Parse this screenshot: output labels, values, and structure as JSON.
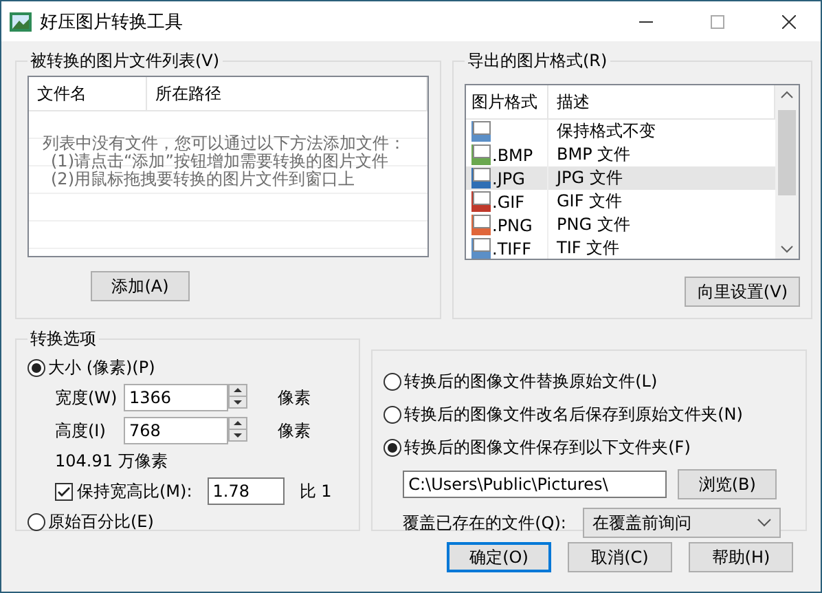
{
  "window": {
    "title": "好压图片转换工具"
  },
  "file_list": {
    "title": "被转换的图片文件列表(V)",
    "columns": [
      "文件名",
      "所在路径"
    ],
    "empty_message": [
      "列表中没有文件，您可以通过以下方法添加文件：",
      "(1)请点击“添加”按钮增加需要转换的图片文件",
      "(2)用鼠标拖拽要转换的图片文件到窗口上"
    ],
    "add_button": "添加(A)"
  },
  "formats": {
    "title": "导出的图片格式(R)",
    "columns": [
      "图片格式",
      "描述"
    ],
    "rows": [
      {
        "format": "",
        "description": "保持格式不变",
        "color": "#5b8fc7",
        "selected": false
      },
      {
        "format": ".BMP",
        "description": "BMP 文件",
        "color": "#6aa84f",
        "selected": false
      },
      {
        "format": ".JPG",
        "description": "JPG 文件",
        "color": "#2f6fb5",
        "selected": true
      },
      {
        "format": ".GIF",
        "description": "GIF 文件",
        "color": "#c0392b",
        "selected": false
      },
      {
        "format": ".PNG",
        "description": "PNG 文件",
        "color": "#e0663a",
        "selected": false
      },
      {
        "format": ".TIFF",
        "description": "TIF 文件",
        "color": "#5b8fc7",
        "selected": false
      }
    ],
    "button": "向里设置(V)"
  },
  "conversion": {
    "title": "转换选项",
    "size_option": {
      "label": "大小 (像素)(P)",
      "selected": true
    },
    "width": {
      "label": "宽度(W)",
      "value": "1366",
      "unit": "像素"
    },
    "height": {
      "label": "高度(I)",
      "value": "768",
      "unit": "像素"
    },
    "megapixels": "104.91 万像素",
    "keep_ratio": {
      "label": "保持宽高比(M):",
      "checked": true,
      "value": "1.78",
      "suffix": "比 1"
    },
    "percent_option": {
      "label": "原始百分比(E)",
      "selected": false
    }
  },
  "output": {
    "options": [
      {
        "label": "转换后的图像文件替换原始文件(L)",
        "selected": false
      },
      {
        "label": "转换后的图像文件改名后保存到原始文件夹(N)",
        "selected": false
      },
      {
        "label": "转换后的图像文件保存到以下文件夹(F)",
        "selected": true
      }
    ],
    "folder": "C:\\Users\\Public\\Pictures\\",
    "browse_button": "浏览(B)",
    "overwrite_label": "覆盖已存在的文件(Q):",
    "overwrite_value": "在覆盖前询问"
  },
  "buttons": [
    {
      "label": "确定(O)",
      "default": true
    },
    {
      "label": "取消(C)",
      "default": false
    },
    {
      "label": "帮助(H)",
      "default": false
    }
  ]
}
